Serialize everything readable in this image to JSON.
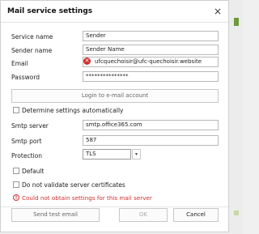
{
  "dialog": {
    "title": "Mail service settings",
    "close_glyph": "×"
  },
  "fields": {
    "service_name": {
      "label": "Service name",
      "value": "Sender"
    },
    "sender_name": {
      "label": "Sender name",
      "value": "Sender Name"
    },
    "email": {
      "label": "Email",
      "value": "ufcquechoisir@ufc-quechoisir.website",
      "status_icon": "error-icon"
    },
    "password": {
      "label": "Password",
      "value": "***************"
    },
    "smtp_server": {
      "label": "Smtp server",
      "value": "smtp.office365.com"
    },
    "smtp_port": {
      "label": "Smtp port",
      "value": "587"
    },
    "protection": {
      "label": "Protection",
      "value": "TLS"
    }
  },
  "buttons": {
    "login": "Login to e-mail account",
    "send_test": "Send test email",
    "ok": "OK",
    "cancel": "Cancel"
  },
  "checkboxes": {
    "determine_auto": "Determine settings automatically",
    "default": "Default",
    "no_validate": "Do not validate server certificates"
  },
  "error_message": "Could not obtain settings for this mail server",
  "colors": {
    "error": "#d32f2f"
  }
}
